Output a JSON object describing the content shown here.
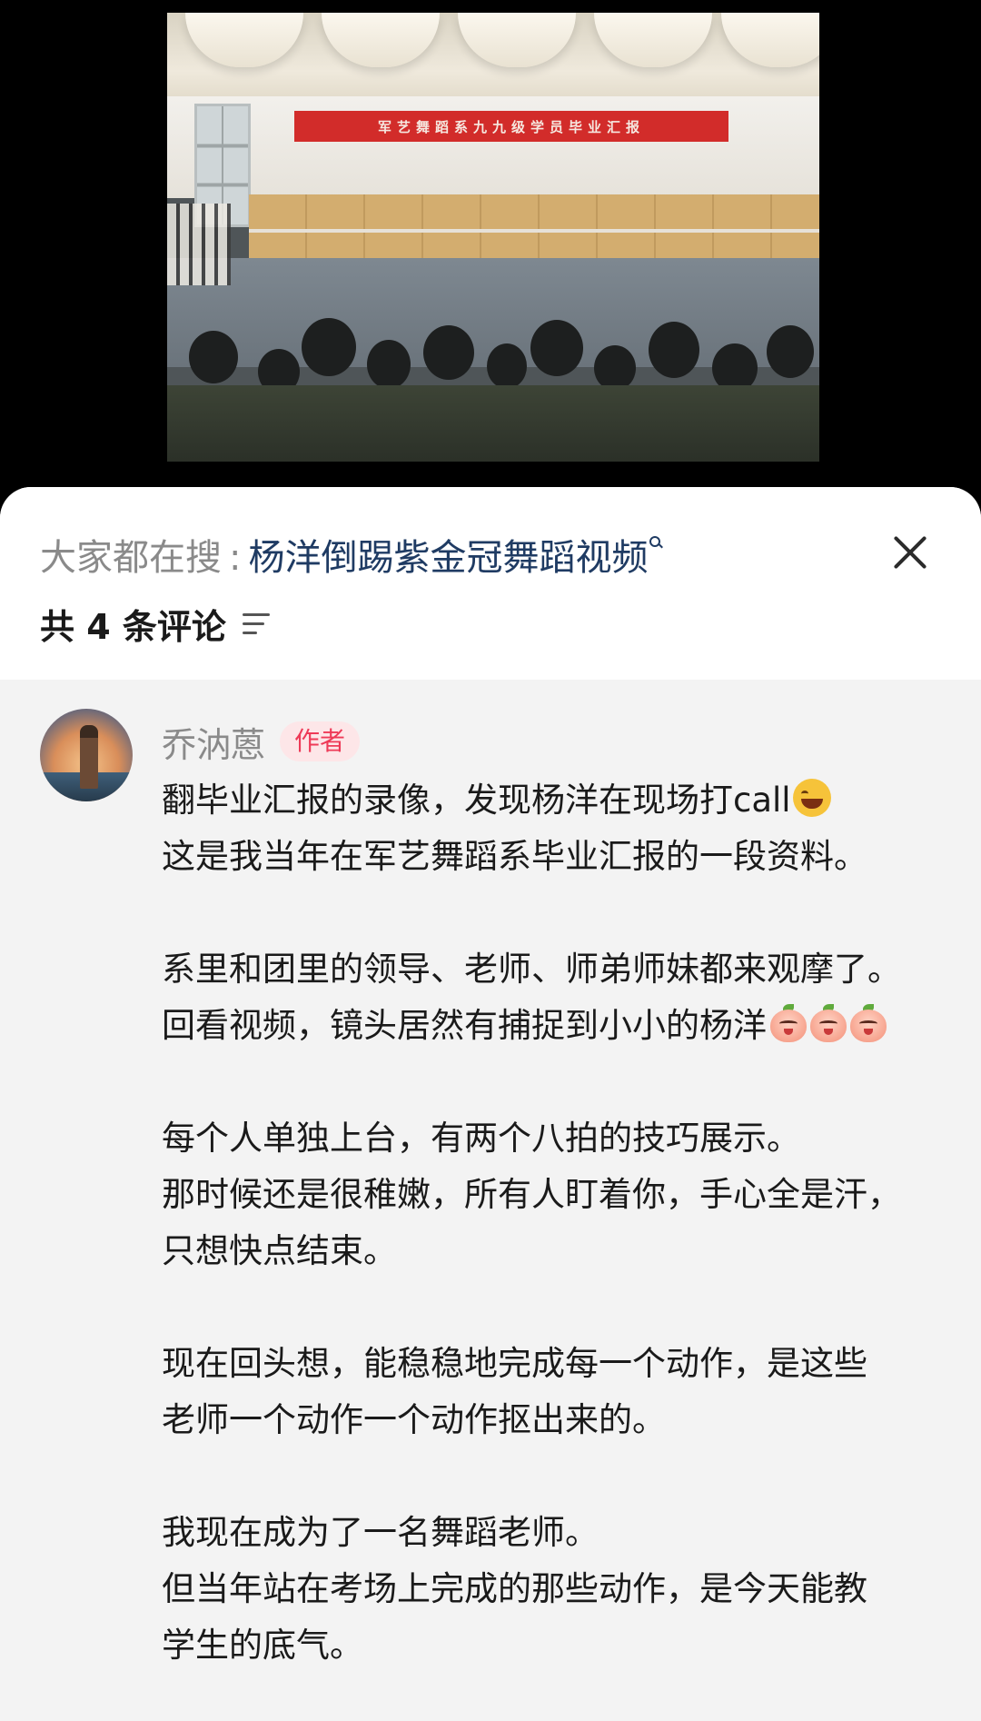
{
  "video": {
    "banner_text": "军艺舞蹈系九九级学员毕业汇报"
  },
  "search_suggest": {
    "prefix": "大家都在搜",
    "separator": ":",
    "term": "杨洋倒踢紫金冠舞蹈视频",
    "icon": "search-icon"
  },
  "header": {
    "comment_count": "共 4 条评论",
    "sort_icon": "sort-icon",
    "close_icon": "close-icon"
  },
  "comment": {
    "author": "乔汭蒽",
    "badge": "作者",
    "paragraphs": [
      [
        "翻毕业汇报的录像，发现杨洋在现场打call",
        "这是我当年在军艺舞蹈系毕业汇报的一段资料。"
      ],
      [
        "系里和团里的领导、老师、师弟师妹都来观摩了。",
        "回看视频，镜头居然有捕捉到小小的杨洋"
      ],
      [
        "每个人单独上台，有两个八拍的技巧展示。",
        "那时候还是很稚嫩，所有人盯着你，手心全是汗，",
        "只想快点结束。"
      ],
      [
        "现在回头想，能稳稳地完成每一个动作，是这些",
        "老师一个动作一个动作抠出来的。"
      ],
      [
        "我现在成为了一名舞蹈老师。",
        "但当年站在考场上完成的那些动作，是今天能教",
        "学生的底气。"
      ]
    ],
    "emojis": {
      "line1": "laughing-emoji",
      "line4": [
        "peach-emoji",
        "peach-emoji",
        "peach-emoji"
      ]
    }
  }
}
